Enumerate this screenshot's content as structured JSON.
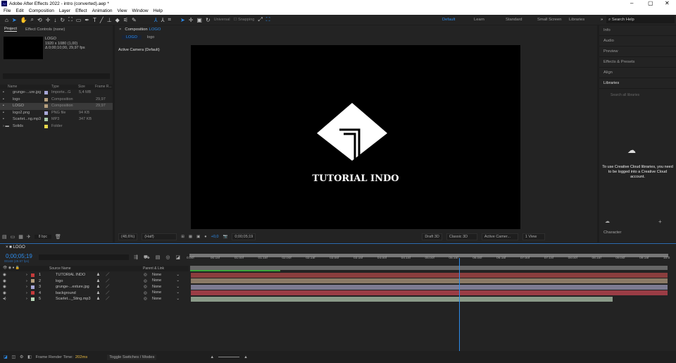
{
  "window": {
    "title": "Adobe After Effects 2022 - intro (converted).aep *",
    "app_icon": "Ae"
  },
  "menu": [
    "File",
    "Edit",
    "Composition",
    "Layer",
    "Effect",
    "Animation",
    "View",
    "Window",
    "Help"
  ],
  "toolbar": {
    "axis_mode": "Universal",
    "snapping": "Snapping"
  },
  "workspaces": [
    "Default",
    "Learn",
    "Standard",
    "Small Screen",
    "Libraries"
  ],
  "search_help": "Search Help",
  "project": {
    "tab": "Project",
    "effect_controls": "Effect Controls (none)",
    "selected_name": "LOGO",
    "selected_res": "1920 x 1080 (1,00)",
    "selected_dur": "Δ 0;00;10;00, 29,97 fps",
    "columns": [
      "Name",
      "Type",
      "Size",
      "Frame R..."
    ],
    "items": [
      {
        "name": "grunge-...ure.jpg",
        "type": "Importe...G",
        "size": "5,4 MB",
        "fps": "",
        "color": "#a8a8d8"
      },
      {
        "name": "logo",
        "type": "Composition",
        "size": "",
        "fps": "29,97",
        "color": "#b59e7d"
      },
      {
        "name": "LOGO",
        "type": "Composition",
        "size": "",
        "fps": "29,97",
        "color": "#b59e7d"
      },
      {
        "name": "logo2.png",
        "type": "PNG file",
        "size": "94 KB",
        "fps": "",
        "color": "#a8a8d8"
      },
      {
        "name": "Scarlet...ng.mp3",
        "type": "MP3",
        "size": "347 KB",
        "fps": "",
        "color": "#a8c8a8"
      },
      {
        "name": "Solids",
        "type": "Folder",
        "size": "",
        "fps": "",
        "color": "#e8d84a"
      }
    ],
    "bpc": "8 bpc"
  },
  "comp": {
    "tab": "Composition",
    "tab_name": "LOGO",
    "crumbs": [
      "LOGO",
      "logo"
    ],
    "camera_label": "Active Camera (Default)",
    "logo_text": "TUTORIAL INDO",
    "zoom": "(48,6%)",
    "resolution": "(Half)",
    "exposure": "+0,0",
    "timecode": "0;00;05;19",
    "renderer_toggle": "Draft 3D",
    "renderer": "Classic 3D",
    "camera": "Active Camer...",
    "views": "1 View"
  },
  "right": {
    "panels": [
      "Info",
      "Audio",
      "Preview",
      "Effects & Presets",
      "Align"
    ],
    "libraries": "Libraries",
    "lib_search": "Search all libraries",
    "lib_message": "To use Creative Cloud libraries, you need to be logged into a Creative Cloud account.",
    "character": "Character"
  },
  "timeline": {
    "tab": "LOGO",
    "timecode": "0;00;05;19",
    "frame_info": "00169 (29.97 fps)",
    "columns": {
      "source": "Source Name",
      "parent": "Parent & Link"
    },
    "current_time_s": 5.63,
    "duration_s": 10,
    "ticks": [
      "0:00f",
      "00:15f",
      "01:00f",
      "01:15f",
      "02:00f",
      "02:15f",
      "03:00f",
      "03:15f",
      "04:00f",
      "04:15f",
      "05:00f",
      "05:15f",
      "06:00f",
      "06:15f",
      "07:00f",
      "07:15f",
      "08:00f",
      "08:15f",
      "09:00f",
      "09:15f",
      "10:0"
    ],
    "layers": [
      {
        "num": "1",
        "name": "TUTORIAL INDO",
        "parent": "None",
        "label": "#c43b3b",
        "bar": "#8a3d3d",
        "end": 10
      },
      {
        "num": "2",
        "name": "logo",
        "parent": "None",
        "label": "#b59e7d",
        "bar": "#8a7a66",
        "end": 10
      },
      {
        "num": "3",
        "name": "grunge-...exture.jpg",
        "parent": "None",
        "label": "#a8a8d8",
        "bar": "#7c7b92",
        "end": 10
      },
      {
        "num": "4",
        "name": "background",
        "parent": "None",
        "label": "#c43b3b",
        "bar": "#9a3c45",
        "end": 10
      },
      {
        "num": "5",
        "name": "Scarlet..._Sting.mp3",
        "parent": "None",
        "label": "#b8d8b8",
        "bar": "#8a9a88",
        "end": 8.85
      }
    ]
  },
  "status": {
    "render_label": "Frame Render Time:",
    "render_time": "202ms",
    "toggle": "Toggle Switches / Modes"
  }
}
